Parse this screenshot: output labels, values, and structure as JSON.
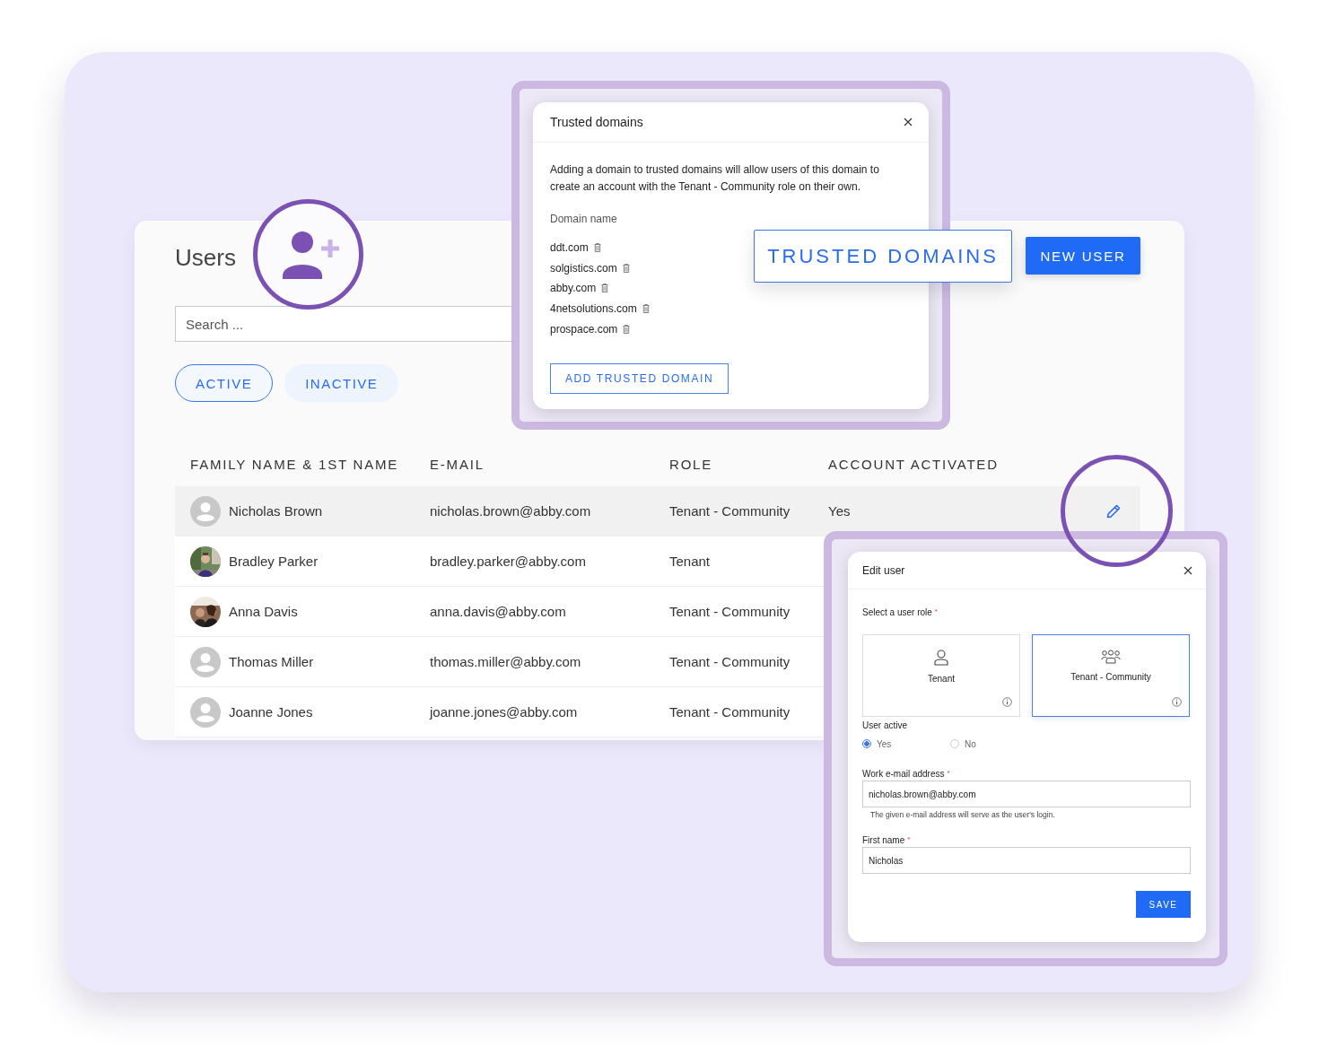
{
  "users_panel": {
    "title": "Users",
    "search": {
      "placeholder": "Search ..."
    },
    "filters": [
      {
        "label": "ACTIVE",
        "selected": true
      },
      {
        "label": "INACTIVE",
        "selected": false
      }
    ],
    "buttons": [
      {
        "label": "TRUSTED DOMAINS",
        "kind": "outline"
      },
      {
        "label": "NEW USER",
        "kind": "primary"
      }
    ],
    "table": {
      "columns": [
        "FAMILY NAME & 1ST NAME",
        "E-MAIL",
        "ROLE",
        "ACCOUNT ACTIVATED"
      ],
      "rows": [
        {
          "kind": "generic",
          "name": "Nicholas Brown",
          "email": "nicholas.brown@abby.com",
          "role": "Tenant - Community",
          "activated": "Yes",
          "selected": true
        },
        {
          "name": "Bradley Parker",
          "email": "bradley.parker@abby.com",
          "role": "Tenant",
          "selected": false
        },
        {
          "name": "Anna Davis",
          "email": "anna.davis@abby.com",
          "role": "Tenant - Community",
          "selected": false
        },
        {
          "kind": "generic",
          "name": "Thomas Miller",
          "email": "thomas.miller@abby.com",
          "role": "Tenant - Community",
          "selected": false
        },
        {
          "kind": "generic",
          "name": "Joanne Jones",
          "email": "joanne.jones@abby.com",
          "role": "Tenant - Community",
          "selected": false
        }
      ]
    }
  },
  "trusted_domains_dialog": {
    "title": "Trusted domains",
    "description": "Adding a domain to trusted domains will allow users of this domain to create an account with the Tenant - Community role on their own.",
    "list_label": "Domain name",
    "domains": [
      "ddt.com",
      "solgistics.com",
      "abby.com",
      "4netsolutions.com",
      "prospace.com"
    ],
    "add_button": "ADD TRUSTED DOMAIN"
  },
  "edit_user_dialog": {
    "title": "Edit user",
    "role_label": "Select a user role",
    "role_required_mark": "*",
    "roles": [
      {
        "label": "Tenant",
        "kind": "single",
        "selected": false
      },
      {
        "label": "Tenant - Community",
        "kind": "group",
        "selected": true
      }
    ],
    "active_label": "User active",
    "active_options": [
      {
        "label": "Yes",
        "selected": true
      },
      {
        "label": "No",
        "selected": false
      }
    ],
    "fields": [
      {
        "label": "Work e-mail address",
        "required_mark": "*",
        "value": "nicholas.brown@abby.com",
        "hint": "The given e-mail address will serve as the user's login."
      },
      {
        "label": "First name",
        "required_mark": "*",
        "value": "Nicholas"
      }
    ],
    "save_button": "SAVE"
  }
}
